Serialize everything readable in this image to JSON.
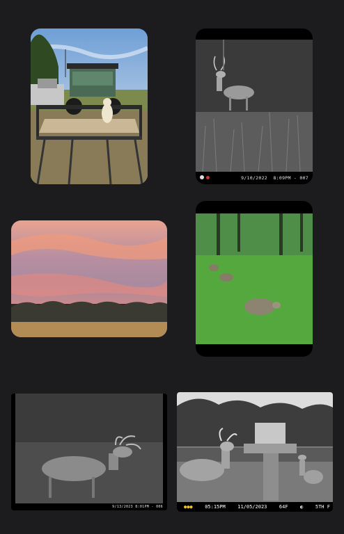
{
  "photos": [
    {
      "name": "utv-dog-trailer-photo",
      "alt_kind": "utv with dog on trailer"
    },
    {
      "name": "trail-cam-buck-night-1",
      "stamp": {
        "date": "9/10/2022",
        "time": "8:09PM",
        "seq": "007"
      }
    },
    {
      "name": "sunset-field-photo"
    },
    {
      "name": "trail-cam-deer-green-photo"
    },
    {
      "name": "trail-cam-buck-night-2",
      "stamp": {
        "date": "9/13/2023",
        "time": "8:01PM",
        "seq": "006"
      }
    },
    {
      "name": "trail-cam-feeder-photo",
      "stamp": {
        "time": "05:15PM",
        "date": "11/05/2023",
        "temp": "64F",
        "moon_icon": "moon-phase-icon",
        "wind": "5TH F"
      }
    }
  ]
}
